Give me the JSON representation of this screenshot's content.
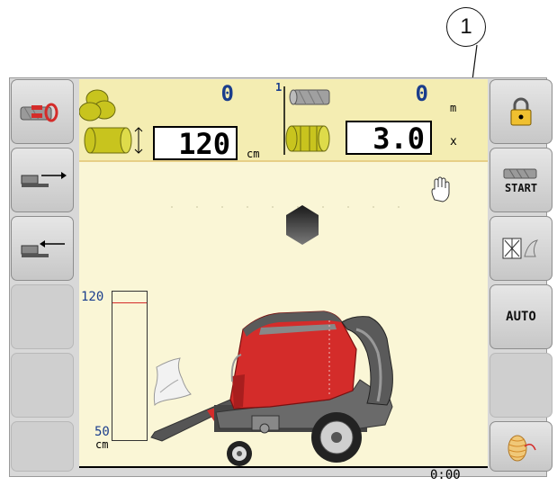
{
  "callout": {
    "number": "1"
  },
  "counters": {
    "bale_count": "0",
    "bale_diameter": "120",
    "bale_diameter_unit": "cm",
    "net_layer_index": "1",
    "net_count": "0",
    "net_length": "3.0",
    "net_length_unit": "m",
    "net_wraps_unit": "x"
  },
  "gauge": {
    "max_label": "120",
    "min_label": "50",
    "unit": "cm",
    "current_marker_value": 115
  },
  "right_buttons": {
    "start_label": "START",
    "auto_label": "AUTO"
  },
  "status": {
    "timer": "0:00"
  },
  "colors": {
    "panel_yellow": "#f4edb2",
    "work_area": "#faf6d6",
    "baler_red": "#d42c2a",
    "value_blue": "#1a3d8c"
  },
  "icons": {
    "left": [
      "bale-counter-reset-icon",
      "cylinder-extend-icon",
      "cylinder-retract-icon"
    ],
    "right": [
      "padlock-icon",
      "start-wrap-icon",
      "knives-toggle-icon",
      "auto-mode",
      "twine-spool-icon"
    ],
    "status": [
      "manual-mode-hand-icon",
      "hexagon-indicator-icon"
    ]
  }
}
